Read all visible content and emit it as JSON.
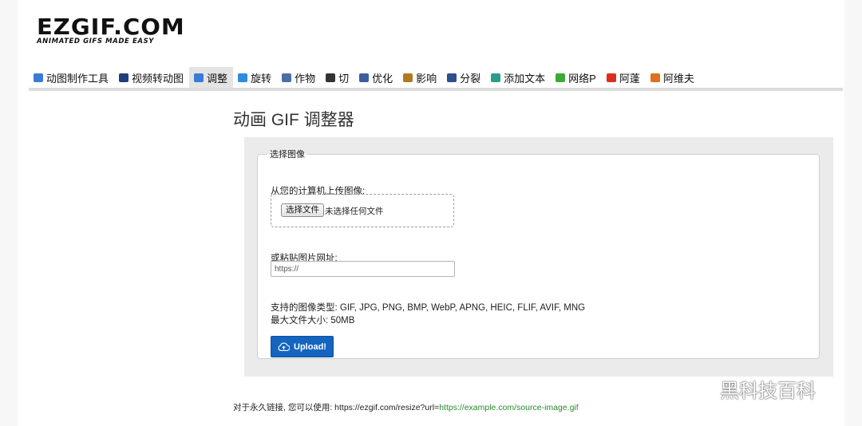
{
  "logo": {
    "main": "EZGIF.COM",
    "tagline": "ANIMATED GIFS MADE EASY"
  },
  "nav": {
    "items": [
      {
        "label": "动图制作工具",
        "icon": "gif-maker-icon",
        "color": "#3a7bd5"
      },
      {
        "label": "视频转动图",
        "icon": "film-icon",
        "color": "#1f3f7a"
      },
      {
        "label": "调整",
        "icon": "resize-icon",
        "color": "#3a7bd5",
        "active": true
      },
      {
        "label": "旋转",
        "icon": "rotate-icon",
        "color": "#2f8be0"
      },
      {
        "label": "作物",
        "icon": "crop-icon",
        "color": "#4a6fa5"
      },
      {
        "label": "切",
        "icon": "cut-icon",
        "color": "#333333"
      },
      {
        "label": "优化",
        "icon": "optimize-icon",
        "color": "#3a5fa0"
      },
      {
        "label": "影响",
        "icon": "effects-icon",
        "color": "#b07a20"
      },
      {
        "label": "分裂",
        "icon": "split-icon",
        "color": "#2d4f8a"
      },
      {
        "label": "添加文本",
        "icon": "add-text-icon",
        "color": "#2a9d8f"
      },
      {
        "label": "网络P",
        "icon": "webp-icon",
        "color": "#3aaa35"
      },
      {
        "label": "阿蓬",
        "icon": "apng-icon",
        "color": "#d9301e"
      },
      {
        "label": "阿维夫",
        "icon": "avif-icon",
        "color": "#e07020"
      }
    ]
  },
  "main": {
    "title": "动画 GIF 调整器",
    "fieldset_legend": "选择图像",
    "upload_label": "从您的计算机上传图像:",
    "file_button": "选择文件",
    "file_status": "未选择任何文件",
    "url_label": "或粘贴图片网址:",
    "url_placeholder": "https://",
    "formats": "支持的图像类型: GIF, JPG, PNG, BMP, WebP, APNG, HEIC, FLIF, AVIF, MNG",
    "max_size": "最大文件大小: 50MB",
    "upload_button": "Upload!"
  },
  "footer": {
    "permalink_prefix": "对于永久链接, 您可以使用: https://ezgif.com/resize?url=",
    "permalink_example": "https://example.com/source-image.gif"
  },
  "watermark": {
    "text": "黑科技百科"
  },
  "colors": {
    "accent": "#1565c0",
    "link_green": "#2a8a2a"
  }
}
